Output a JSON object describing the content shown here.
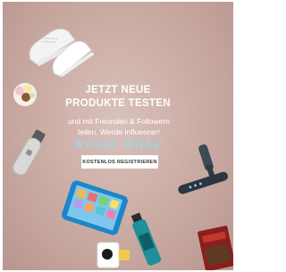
{
  "banner": {
    "headline_lines": [
      "JETZT NEUE",
      "PRODUKTE TESTEN"
    ],
    "subtext_lines": [
      "und mit Freunden & Followern",
      "teilen. Werde Influencer!"
    ],
    "hashtag": "#love #like",
    "cta_label": "KOSTENLOS REGISTRIEREN",
    "product_icons": [
      "sneakers-icon",
      "ice-cream-icon",
      "shaver-icon",
      "vacuum-icon",
      "tablet-icon",
      "spray-bottle-icon",
      "tube-icon",
      "coffee-pack-icon"
    ],
    "colors": {
      "background": "#c9aaa2",
      "text": "#ffffff",
      "hashtag": "#9dd6e6",
      "button_bg": "#ffffff"
    }
  }
}
